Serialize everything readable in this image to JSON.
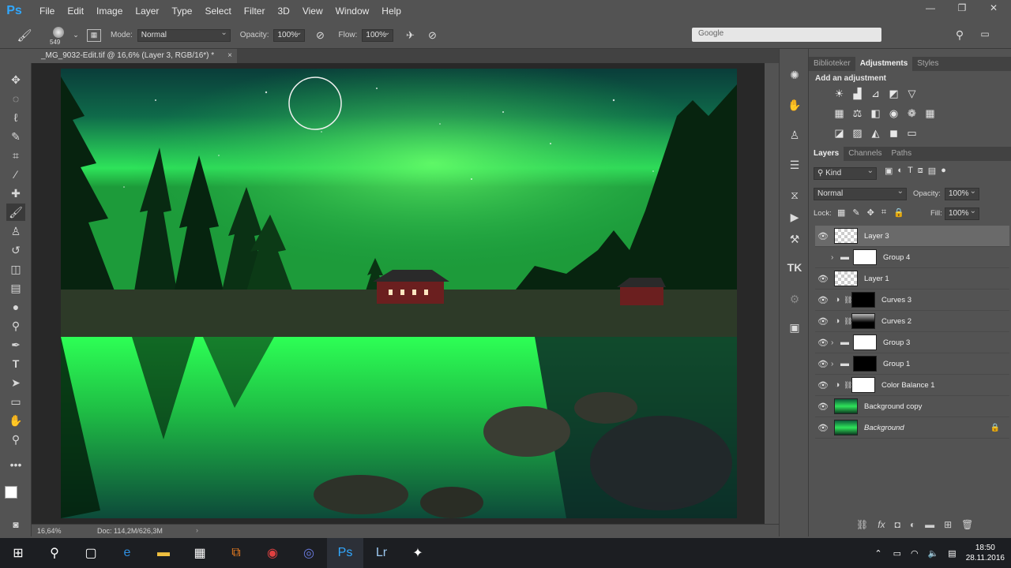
{
  "app": {
    "logo": "Ps"
  },
  "menu": [
    "File",
    "Edit",
    "Image",
    "Layer",
    "Type",
    "Select",
    "Filter",
    "3D",
    "View",
    "Window",
    "Help"
  ],
  "options": {
    "brush_size": "549",
    "mode_label": "Mode:",
    "mode_value": "Normal",
    "opacity_label": "Opacity:",
    "opacity_value": "100%",
    "flow_label": "Flow:",
    "flow_value": "100%",
    "search_placeholder": "Google"
  },
  "document": {
    "tab_title": "_MG_9032-Edit.tif @ 16,6% (Layer 3, RGB/16*) *",
    "zoom": "16,64%",
    "doc_info": "Doc: 114,2M/626,3M"
  },
  "panel_top": {
    "tabs": [
      "Biblioteker",
      "Adjustments",
      "Styles"
    ],
    "active_tab": "Adjustments",
    "title": "Add an adjustment"
  },
  "panel_layers": {
    "tabs": [
      "Layers",
      "Channels",
      "Paths"
    ],
    "filter_kind": "Kind",
    "blend_mode": "Normal",
    "opacity_label": "Opacity:",
    "opacity_value": "100%",
    "lock_label": "Lock:",
    "fill_label": "Fill:",
    "fill_value": "100%",
    "layers": [
      {
        "name": "Layer 3",
        "type": "pixel",
        "visible": true,
        "selected": true
      },
      {
        "name": "Group 4",
        "type": "group",
        "visible": false
      },
      {
        "name": "Layer 1",
        "type": "pixel",
        "visible": true
      },
      {
        "name": "Curves 3",
        "type": "adjustment",
        "visible": true
      },
      {
        "name": "Curves 2",
        "type": "adjustment",
        "visible": true
      },
      {
        "name": "Group 3",
        "type": "group",
        "visible": true
      },
      {
        "name": "Group 1",
        "type": "group",
        "visible": true
      },
      {
        "name": "Color Balance 1",
        "type": "adjustment",
        "visible": true
      },
      {
        "name": "Background copy",
        "type": "image",
        "visible": true
      },
      {
        "name": "Background",
        "type": "image",
        "visible": true,
        "locked": true
      }
    ]
  },
  "taskbar": {
    "time": "18:50",
    "date": "28.11.2016"
  },
  "colors": {
    "ui_bg": "#535353",
    "canvas_bg": "#282828",
    "aurora": "#2dff5a",
    "taskbar": "#1c1e22"
  }
}
